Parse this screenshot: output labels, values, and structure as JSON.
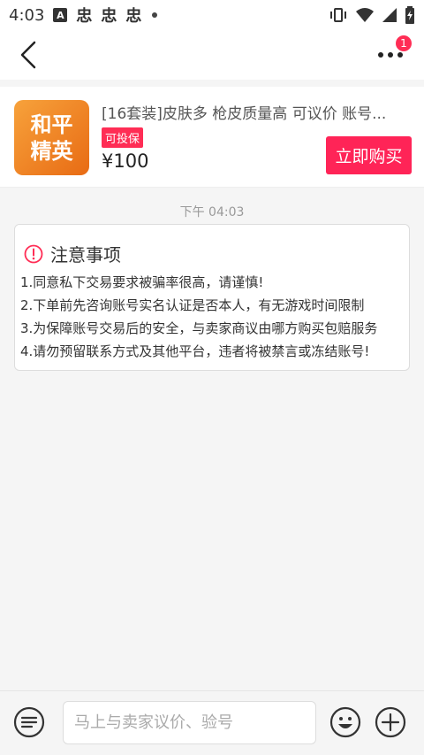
{
  "status": {
    "time": "4:03",
    "notif_a": "A",
    "notif_glyphs": [
      "忠",
      "忠",
      "忠"
    ]
  },
  "navbar": {
    "more_badge": "1"
  },
  "product": {
    "thumb_line1": "和平",
    "thumb_line2": "精英",
    "title": "[16套装]皮肤多 枪皮质量高 可议价 账号...",
    "tag": "可投保",
    "price": "¥100",
    "buy_label": "立即购买"
  },
  "chat": {
    "timestamp": "下午 04:03",
    "notice_title": "注意事项",
    "notice_lines": [
      "1.同意私下交易要求被骗率很高，请谨慎!",
      "2.下单前先咨询账号实名认证是否本人，有无游戏时间限制",
      "3.为保障账号交易后的安全，与卖家商议由哪方购买包赔服务",
      "4.请勿预留联系方式及其他平台，违者将被禁言或冻结账号!"
    ]
  },
  "input": {
    "placeholder": "马上与卖家议价、验号"
  },
  "colors": {
    "accent": "#ff2457",
    "badge": "#ff2d55"
  }
}
